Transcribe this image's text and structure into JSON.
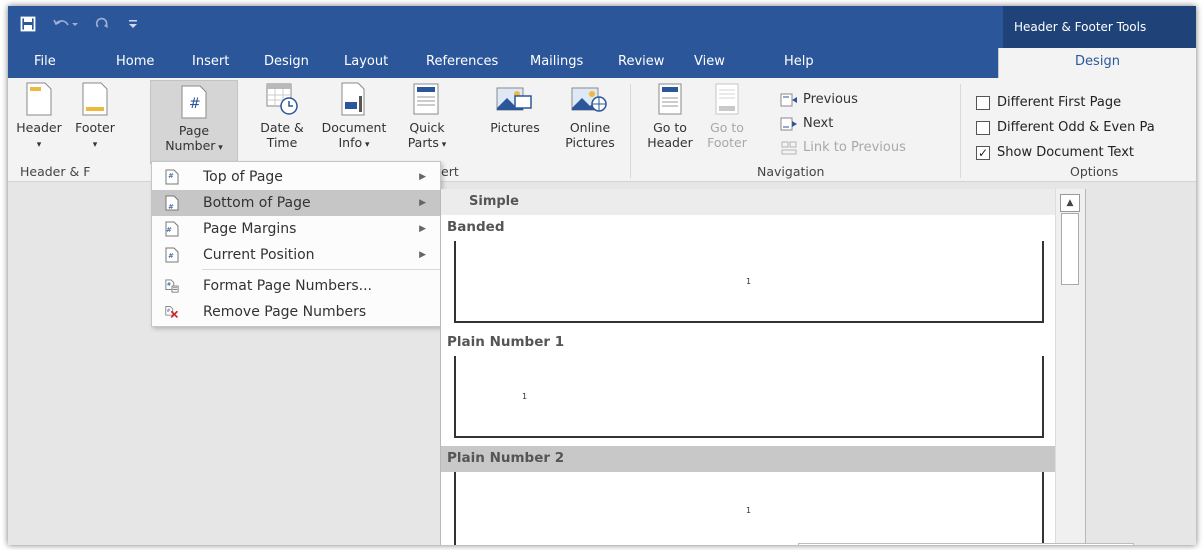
{
  "window": {
    "contextual_title": "Header & Footer Tools"
  },
  "tabs": [
    {
      "label": "File"
    },
    {
      "label": "Home"
    },
    {
      "label": "Insert"
    },
    {
      "label": "Design"
    },
    {
      "label": "Layout"
    },
    {
      "label": "References"
    },
    {
      "label": "Mailings"
    },
    {
      "label": "Review"
    },
    {
      "label": "View"
    },
    {
      "label": "Help"
    },
    {
      "label": "Design"
    }
  ],
  "ribbon": {
    "header": {
      "label": "Header"
    },
    "footer": {
      "label": "Footer"
    },
    "page_number": {
      "line1": "Page",
      "line2": "Number"
    },
    "date_time": {
      "line1": "Date &",
      "line2": "Time"
    },
    "document_info": {
      "line1": "Document",
      "line2": "Info"
    },
    "quick_parts": {
      "line1": "Quick",
      "line2": "Parts"
    },
    "pictures": {
      "label": "Pictures"
    },
    "online_pictures": {
      "line1": "Online",
      "line2": "Pictures"
    },
    "goto_header": {
      "line1": "Go to",
      "line2": "Header"
    },
    "goto_footer": {
      "line1": "Go to",
      "line2": "Footer"
    },
    "previous": {
      "label": "Previous"
    },
    "next": {
      "label": "Next"
    },
    "link_to_previous": {
      "label": "Link to Previous"
    },
    "groups": {
      "header_footer": "Header & F",
      "insert": "ert",
      "navigation": "Navigation",
      "options": "Options"
    },
    "options": [
      {
        "label": "Different First Page",
        "checked": false
      },
      {
        "label": "Different Odd & Even Pa",
        "checked": false
      },
      {
        "label": "Show Document Text",
        "checked": true
      }
    ]
  },
  "page_number_menu": {
    "items": [
      {
        "label": "Top of Page",
        "has_submenu": true
      },
      {
        "label": "Bottom of Page",
        "has_submenu": true,
        "highlighted": true
      },
      {
        "label": "Page Margins",
        "has_submenu": true
      },
      {
        "label": "Current Position",
        "has_submenu": true
      },
      {
        "label": "Format Page Numbers...",
        "has_submenu": false
      },
      {
        "label": "Remove Page Numbers",
        "has_submenu": false
      }
    ]
  },
  "gallery": {
    "section": "Simple",
    "entries": [
      {
        "label": "Banded",
        "number": "1"
      },
      {
        "label": "Plain Number 1",
        "number": "1"
      },
      {
        "label": "Plain Number 2",
        "number": "1",
        "highlighted": true
      }
    ]
  },
  "colors": {
    "accent": "#2b579a",
    "contextual": "#1f4379",
    "ribbon_bg": "#f3f3f3",
    "highlight": "#c6c6c6"
  },
  "icons": {
    "save": "save-icon",
    "undo": "undo-icon",
    "redo": "redo-icon",
    "customize": "customize-qat-icon"
  }
}
